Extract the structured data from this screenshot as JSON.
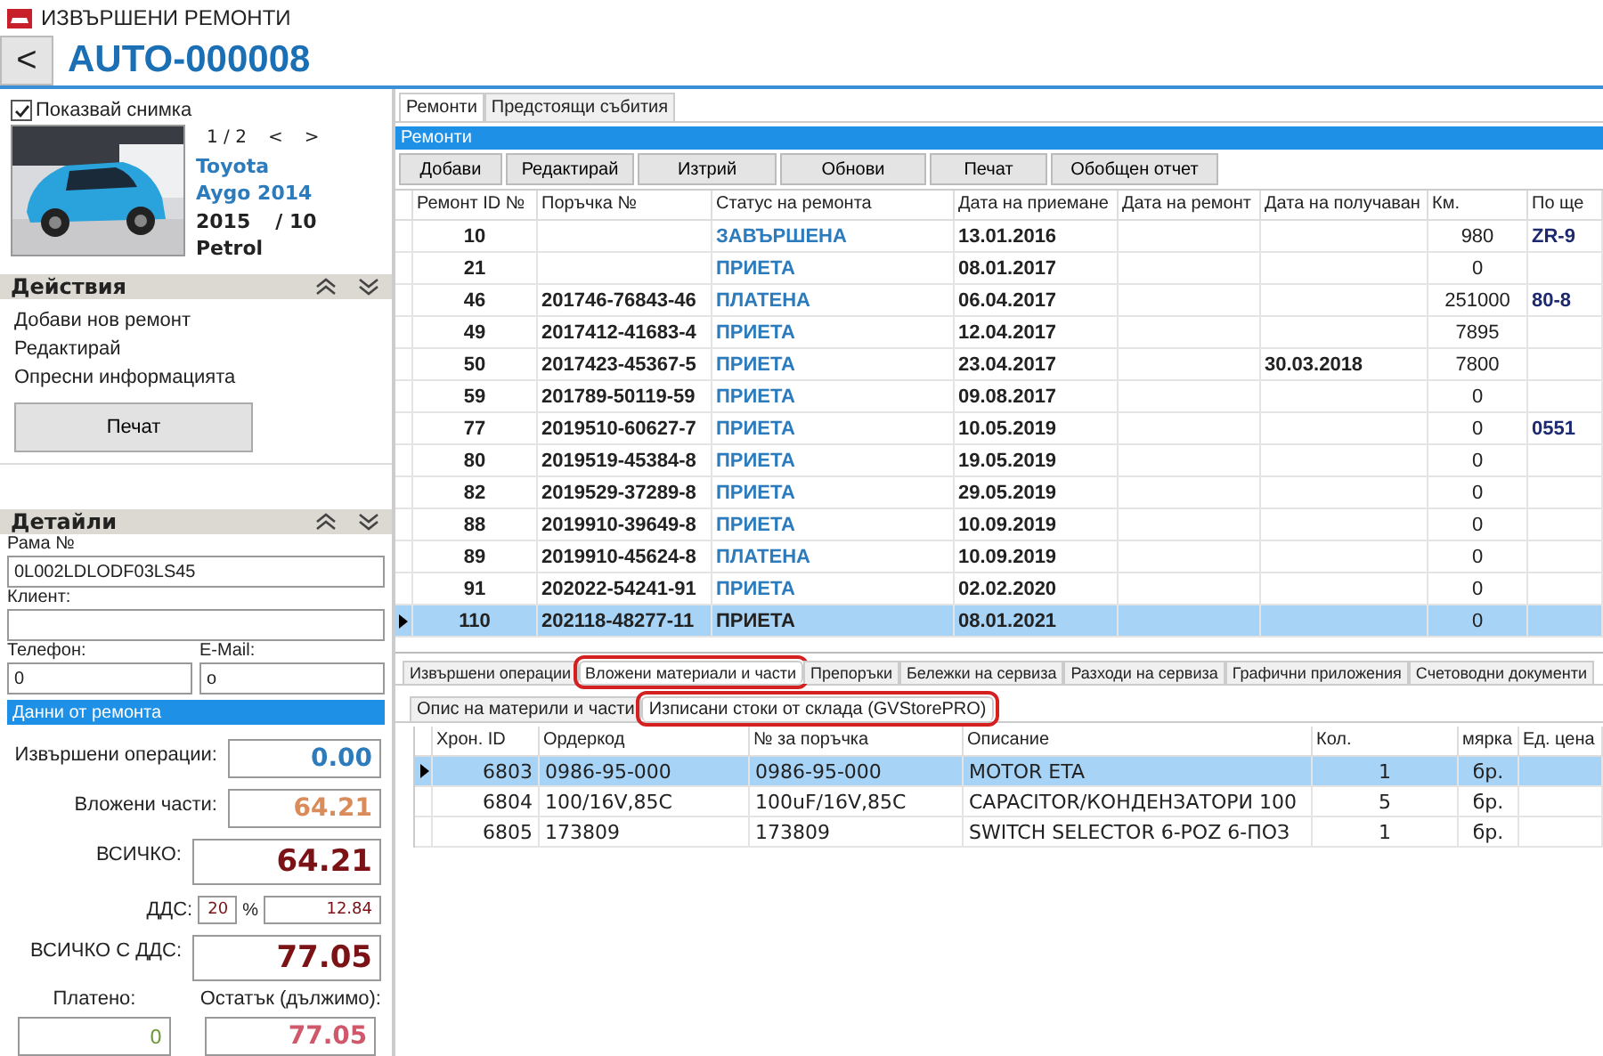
{
  "window": {
    "title": "ИЗВЪРШЕНИ РЕМОНТИ"
  },
  "header": {
    "back": "<",
    "code": "AUTO-000008"
  },
  "vehicle": {
    "show_photo": {
      "label": "Показвай снимка",
      "checked": true
    },
    "pager": "1 / 2",
    "prev": "<",
    "next": ">",
    "make": "Toyota",
    "model": "Aygo 2014",
    "year": "2015",
    "month": "/ 10",
    "fuel": "Petrol"
  },
  "actions": {
    "title": "Действия",
    "items": [
      "Добави нов ремонт",
      "Редактирай",
      "Опресни информацията"
    ],
    "button": "Печат"
  },
  "details": {
    "title": "Детайли",
    "frame": {
      "label": "Рама №",
      "value": "0L002LDLODF03LS45"
    },
    "client": {
      "label": "Клиент:"
    },
    "phone": {
      "label": "Телефон:",
      "value": "0"
    },
    "email": {
      "label": "E-Mail:",
      "value": "o"
    }
  },
  "repair_data": {
    "title": "Данни от ремонта",
    "operations": {
      "label": "Извършени операции:",
      "value": "0.00"
    },
    "parts": {
      "label": "Вложени части:",
      "value": "64.21"
    },
    "total": {
      "label": "ВСИЧКО:",
      "value": "64.21"
    },
    "vat": {
      "label": "ДДС:",
      "rate": "20",
      "percent": "%",
      "value": "12.84"
    },
    "total_with_vat": {
      "label": "ВСИЧКО С ДДС:",
      "value": "77.05"
    },
    "paid": {
      "label": "Платено:",
      "value": "0"
    },
    "remaining": {
      "label": "Остатък (дължимо):",
      "value": "77.05"
    }
  },
  "main_tabs": [
    {
      "label": "Ремонти",
      "selected": true
    },
    {
      "label": "Предстоящи събития",
      "selected": false
    }
  ],
  "repairs": {
    "title": "Ремонти",
    "buttons": [
      "Добави",
      "Редактирай",
      "Изтрий",
      "Обнови",
      "Печат",
      "Обобщен отчет"
    ],
    "columns": [
      "Ремонт ID №",
      "Поръчка №",
      "Статус на ремонта",
      "Дата на приемане",
      "Дата на ремонт",
      "Дата на получаван",
      "Км.",
      "По ще"
    ],
    "rows": [
      {
        "cells": [
          "10",
          null,
          "ЗАВЪРШЕНА",
          "13.01.2016",
          null,
          null,
          "980",
          "ZR-9"
        ],
        "selected": false
      },
      {
        "cells": [
          "21",
          null,
          "ПРИЕТА",
          "08.01.2017",
          null,
          null,
          "0",
          null
        ],
        "selected": false
      },
      {
        "cells": [
          "46",
          "201746-76843-46",
          "ПЛАТЕНА",
          "06.04.2017",
          null,
          null,
          "251000",
          "80-8"
        ],
        "selected": false
      },
      {
        "cells": [
          "49",
          "2017412-41683-4",
          "ПРИЕТА",
          "12.04.2017",
          null,
          null,
          "7895",
          null
        ],
        "selected": false
      },
      {
        "cells": [
          "50",
          "2017423-45367-5",
          "ПРИЕТА",
          "23.04.2017",
          null,
          "30.03.2018",
          "7800",
          null
        ],
        "selected": false
      },
      {
        "cells": [
          "59",
          "201789-50119-59",
          "ПРИЕТА",
          "09.08.2017",
          null,
          null,
          "0",
          null
        ],
        "selected": false
      },
      {
        "cells": [
          "77",
          "2019510-60627-7",
          "ПРИЕТА",
          "10.05.2019",
          null,
          null,
          "0",
          "0551"
        ],
        "selected": false
      },
      {
        "cells": [
          "80",
          "2019519-45384-8",
          "ПРИЕТА",
          "19.05.2019",
          null,
          null,
          "0",
          null
        ],
        "selected": false
      },
      {
        "cells": [
          "82",
          "2019529-37289-8",
          "ПРИЕТА",
          "29.05.2019",
          null,
          null,
          "0",
          null
        ],
        "selected": false
      },
      {
        "cells": [
          "88",
          "2019910-39649-8",
          "ПРИЕТА",
          "10.09.2019",
          null,
          null,
          "0",
          null
        ],
        "selected": false
      },
      {
        "cells": [
          "89",
          "2019910-45624-8",
          "ПЛАТЕНА",
          "10.09.2019",
          null,
          null,
          "0",
          null
        ],
        "selected": false
      },
      {
        "cells": [
          "91",
          "202022-54241-91",
          "ПРИЕТА",
          "02.02.2020",
          null,
          null,
          "0",
          null
        ],
        "selected": false
      },
      {
        "cells": [
          "110",
          "202118-48277-11",
          "ПРИЕТА",
          "08.01.2021",
          null,
          null,
          "0",
          null
        ],
        "selected": true
      }
    ]
  },
  "detail_tabs": [
    {
      "label": "Извършени операции",
      "selected": false,
      "circled": false
    },
    {
      "label": "Вложени материали и части",
      "selected": true,
      "circled": true
    },
    {
      "label": "Препоръки",
      "selected": false,
      "circled": false
    },
    {
      "label": "Бележки на сервиза",
      "selected": false,
      "circled": false
    },
    {
      "label": "Разходи на сервиза",
      "selected": false,
      "circled": false
    },
    {
      "label": "Графични приложения",
      "selected": false,
      "circled": false
    },
    {
      "label": "Счетоводни документи",
      "selected": false,
      "circled": false
    }
  ],
  "sub_tabs": [
    {
      "label": "Опис на материли и части",
      "selected": false,
      "circled": false
    },
    {
      "label": "Изписани стоки от склада (GVStorePRO)",
      "selected": true,
      "circled": true
    }
  ],
  "items": {
    "columns": [
      "Хрон. ID",
      "Ордеркод",
      "№ за поръчка",
      "Описание",
      "Кол.",
      "мярка",
      "Ед. цена"
    ],
    "rows": [
      {
        "cells": [
          "6803",
          "0986-95-000",
          "0986-95-000",
          "MOTOR ETA",
          "1",
          "бр."
        ],
        "selected": true
      },
      {
        "cells": [
          "6804",
          "100/16V,85C",
          "100uF/16V,85C",
          "CAPACITOR/КОНДЕНЗАТОРИ 100",
          "5",
          "бр."
        ],
        "selected": false
      },
      {
        "cells": [
          "6805",
          "173809",
          "173809",
          "SWITCH SELECTOR 6-POZ  6-ПОЗ",
          "1",
          "бр."
        ],
        "selected": false
      }
    ]
  }
}
